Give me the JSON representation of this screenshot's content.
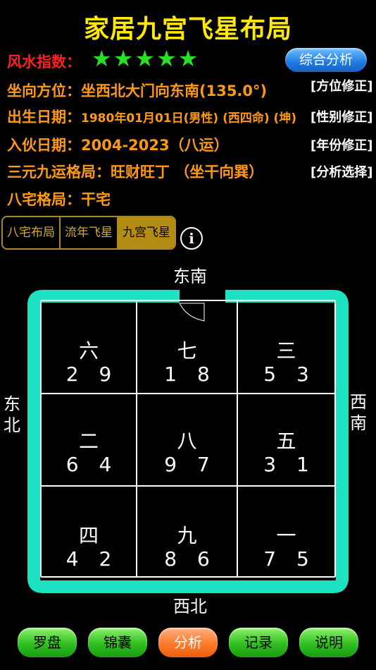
{
  "title": "家居九宫飞星布局",
  "fengshui": {
    "label": "风水指数：",
    "stars": 5,
    "analyze_button": "综合分析"
  },
  "rows": [
    {
      "label": "坐向方位：",
      "value": "坐西北大门向东南(135.0°)",
      "link": "[方位修正]"
    },
    {
      "label": "出生日期：",
      "value": "1980年01月01日(男性) (西四命) (坤)",
      "link": "[性别修正]"
    },
    {
      "label": "入伙日期：",
      "value": "2004-2023（八运）",
      "link": "[年份修正]"
    },
    {
      "label": "三元九运格局：",
      "value": "旺财旺丁 （坐干向巽）",
      "link": "[分析选择]"
    },
    {
      "label": "八宅格局：",
      "value": "干宅",
      "link": ""
    }
  ],
  "tabs": [
    "八宅布局",
    "流年飞星",
    "九宫飞星"
  ],
  "info_icon": "i",
  "directions": {
    "top": "东南",
    "bottom": "西北",
    "left": "东北",
    "right": "西南"
  },
  "cells": [
    {
      "gua": "六",
      "num": "2 9"
    },
    {
      "gua": "七",
      "num": "1 8"
    },
    {
      "gua": "三",
      "num": "5 3"
    },
    {
      "gua": "二",
      "num": "6 4"
    },
    {
      "gua": "八",
      "num": "9 7"
    },
    {
      "gua": "五",
      "num": "3 1"
    },
    {
      "gua": "四",
      "num": "4 2"
    },
    {
      "gua": "九",
      "num": "8 6"
    },
    {
      "gua": "一",
      "num": "7 5"
    }
  ],
  "bottom_buttons": [
    "罗盘",
    "锦囊",
    "分析",
    "记录",
    "说明"
  ],
  "colors": {
    "title": "#ffe900",
    "star": "#27e02a",
    "wall": "#1de3c3",
    "orange": "#ff9a10",
    "red": "#ff2020"
  }
}
